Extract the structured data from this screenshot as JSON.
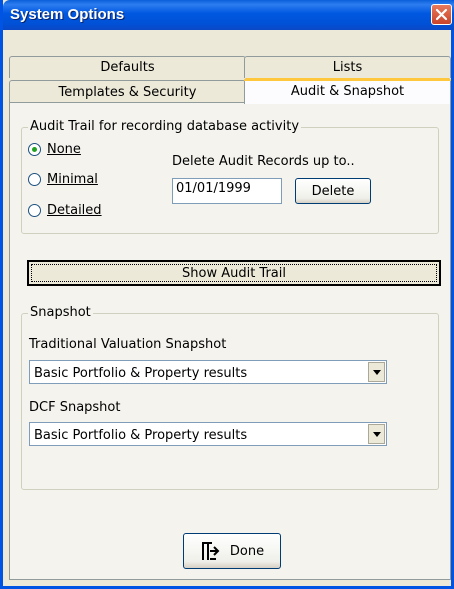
{
  "window": {
    "title": "System Options"
  },
  "tabs": {
    "row1": [
      "Defaults",
      "Lists"
    ],
    "row2": [
      "Templates & Security",
      "Audit & Snapshot"
    ],
    "active": "Audit & Snapshot"
  },
  "audit": {
    "group_label": "Audit Trail for recording database activity",
    "options": [
      "None",
      "Minimal",
      "Detailed"
    ],
    "selected": "None",
    "delete_label": "Delete Audit Records up to..",
    "date_value": "01/01/1999",
    "delete_button": "Delete",
    "show_button": "Show Audit Trail"
  },
  "snapshot": {
    "group_label": "Snapshot",
    "traditional_label": "Traditional Valuation Snapshot",
    "traditional_value": "Basic Portfolio & Property results",
    "dcf_label": "DCF Snapshot",
    "dcf_value": "Basic Portfolio & Property results"
  },
  "footer": {
    "done_button": "Done"
  },
  "icons": {
    "close": "close-icon",
    "dropdown": "chevron-down-icon",
    "done": "exit-door-icon"
  },
  "colors": {
    "title_bar": "#0058e0",
    "close_button": "#c9442a",
    "radio_dot": "#21a121",
    "tab_highlight": "#ffc83c"
  }
}
